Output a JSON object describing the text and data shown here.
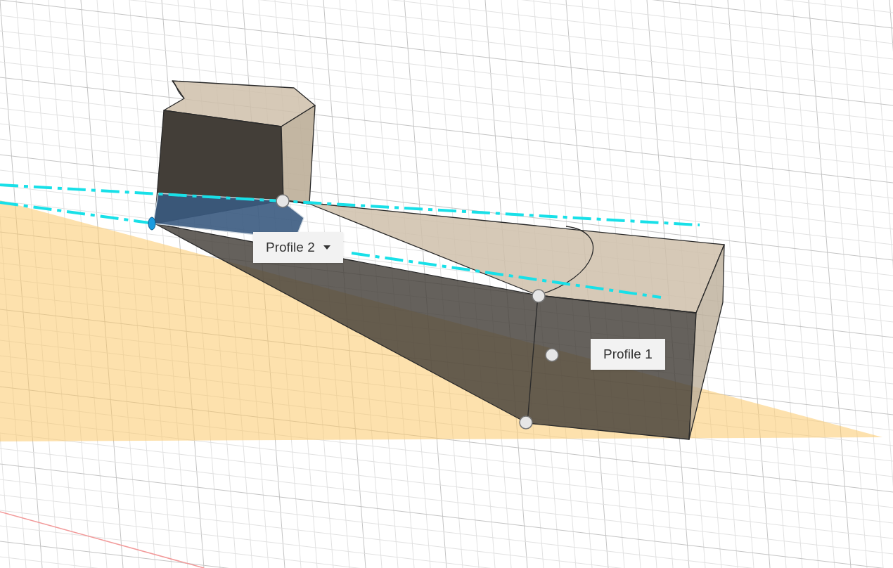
{
  "viewport": {
    "labels": [
      {
        "text": "Profile 2",
        "dropdown": true
      },
      {
        "text": "Profile 1",
        "dropdown": false
      }
    ]
  }
}
